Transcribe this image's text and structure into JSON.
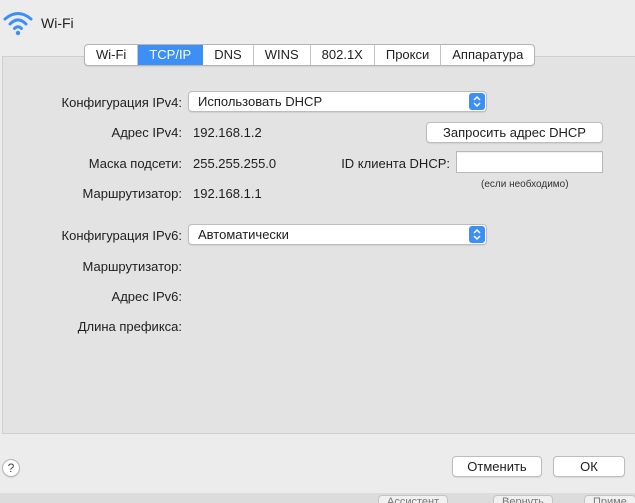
{
  "header": {
    "title": "Wi-Fi",
    "icon": "wifi-icon"
  },
  "tabs": [
    {
      "label": "Wi-Fi",
      "active": false
    },
    {
      "label": "TCP/IP",
      "active": true
    },
    {
      "label": "DNS",
      "active": false
    },
    {
      "label": "WINS",
      "active": false
    },
    {
      "label": "802.1X",
      "active": false
    },
    {
      "label": "Прокси",
      "active": false
    },
    {
      "label": "Аппаратура",
      "active": false
    }
  ],
  "ipv4": {
    "config_label": "Конфигурация IPv4:",
    "config_value": "Использовать DHCP",
    "address_label": "Адрес IPv4:",
    "address_value": "192.168.1.2",
    "mask_label": "Маска подсети:",
    "mask_value": "255.255.255.0",
    "router_label": "Маршрутизатор:",
    "router_value": "192.168.1.1",
    "renew_button": "Запросить адрес DHCP",
    "client_id_label": "ID клиента DHCP:",
    "client_id_value": "",
    "client_id_hint": "(если необходимо)"
  },
  "ipv6": {
    "config_label": "Конфигурация IPv6:",
    "config_value": "Автоматически",
    "router_label": "Маршрутизатор:",
    "address_label": "Адрес IPv6:",
    "prefix_label": "Длина префикса:"
  },
  "footer": {
    "help": "?",
    "cancel": "Отменить",
    "ok": "ОК",
    "background_buttons": [
      "Ассистент",
      "Вернуть",
      "Приме"
    ]
  },
  "colors": {
    "accent": "#3b8ff5",
    "background": "#ececec",
    "panel": "#e3e3e3"
  }
}
